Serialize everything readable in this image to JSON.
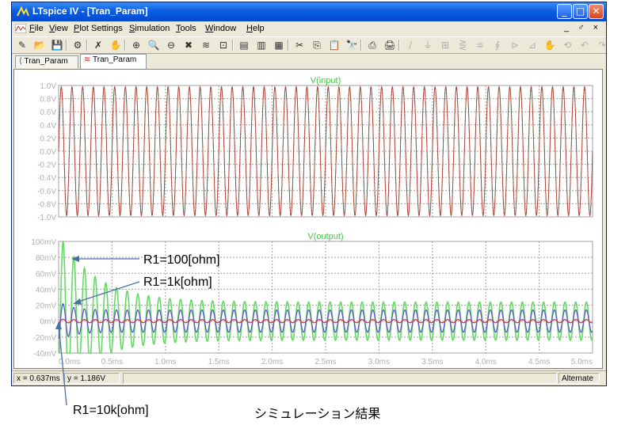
{
  "window": {
    "title": "LTspice IV - [Tran_Param]",
    "controls": {
      "minimize": "_",
      "maximize": "□",
      "close": "✕"
    },
    "title_icon": "ltspice-app-icon"
  },
  "menu": {
    "items": [
      "File",
      "View",
      "Plot Settings",
      "Simulation",
      "Tools",
      "Window",
      "Help"
    ],
    "mdi_controls": "_ ♂ ×"
  },
  "toolbar": {
    "icons": [
      "open-schematic-icon",
      "open-file-icon",
      "save-icon",
      "control-panel-icon",
      "run-icon",
      "halt-icon",
      "zoom-in-icon",
      "zoom-pan-icon",
      "zoom-out-icon",
      "zoom-cancel-icon",
      "autorange-icon",
      "zoom-full-icon",
      "tile-horizontal-icon",
      "cascade-icon",
      "tile-vertical-icon",
      "cut-icon",
      "copy-icon",
      "paste-icon",
      "find-icon",
      "print-setup-icon",
      "print-icon",
      "wire-icon",
      "ground-icon",
      "label-icon",
      "resistor-icon",
      "capacitor-icon",
      "inductor-icon",
      "diode-icon",
      "component-icon",
      "move-icon",
      "drag-icon",
      "undo-icon",
      "redo-icon"
    ]
  },
  "tabs": [
    {
      "label": "Tran_Param",
      "icon": "schematic-icon",
      "active": false
    },
    {
      "label": "Tran_Param",
      "icon": "waveform-icon",
      "active": true
    }
  ],
  "colors": {
    "grid": "#a0a0a0",
    "axis_text": "#b0b0b0",
    "trace_green": "#66d866",
    "trace_blue": "#5a5ac8",
    "trace_red": "#c83c3c",
    "trace_dark": "#7a3a5a",
    "title_green": "#4cc24c",
    "annotation_line": "#4a6fa8"
  },
  "chart_data": [
    {
      "type": "line",
      "title": "V(input)",
      "y_ticks": [
        "1.0V",
        "0.8V",
        "0.6V",
        "0.4V",
        "0.2V",
        "0.0V",
        "-0.2V",
        "-0.4V",
        "-0.6V",
        "-0.8V",
        "-1.0V"
      ],
      "ylim": [
        -1.0,
        1.0
      ],
      "xlim": [
        0,
        5.0
      ],
      "frequency_khz": 10,
      "series": []
    },
    {
      "type": "line",
      "title": "V(output)",
      "y_ticks": [
        "100mV",
        "80mV",
        "60mV",
        "40mV",
        "20mV",
        "0mV",
        "-20mV",
        "-40mV"
      ],
      "ylim": [
        -40,
        100
      ],
      "x_ticks": [
        "0.0ms",
        "0.5ms",
        "1.0ms",
        "1.5ms",
        "2.0ms",
        "2.5ms",
        "3.0ms",
        "3.5ms",
        "4.0ms",
        "4.5ms",
        "5.0ms"
      ],
      "xlim": [
        0,
        5.0
      ],
      "frequency_khz": 10,
      "series": [
        {
          "name": "R1=100[ohm]",
          "steady_amplitude_mv": 24,
          "peak_mv": 98,
          "color": "#66d866"
        },
        {
          "name": "R1=1k[ohm]",
          "steady_amplitude_mv": 14,
          "peak_mv": 25,
          "color": "#5a5ac8"
        },
        {
          "name": "R1=10k[ohm]",
          "steady_amplitude_mv": 2,
          "peak_mv": 3,
          "color": "#c83c3c"
        }
      ]
    }
  ],
  "annotations": {
    "r100": "R1=100[ohm]",
    "r1k": "R1=1k[ohm]",
    "r10k": "R1=10k[ohm]"
  },
  "status": {
    "x": "x = 0.637ms",
    "y": "y = 1.186V",
    "mode": "Alternate"
  },
  "caption": "シミュレーション結果"
}
